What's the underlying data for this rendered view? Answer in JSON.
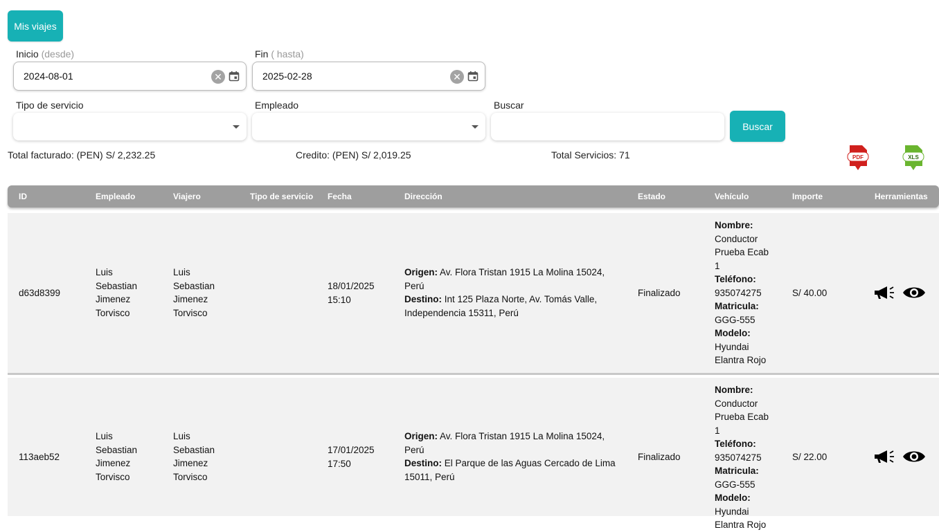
{
  "header": {
    "mis_viajes_label": "Mis viajes"
  },
  "filters": {
    "inicio_label": "Inicio",
    "inicio_hint": "(desde)",
    "inicio_value": "2024-08-01",
    "fin_label": "Fin",
    "fin_hint": "( hasta)",
    "fin_value": "2025-02-28",
    "tipo_servicio_label": "Tipo de servicio",
    "empleado_label": "Empleado",
    "buscar_label": "Buscar",
    "buscar_value": "",
    "buscar_button": "Buscar"
  },
  "summary": {
    "total_facturado": "Total facturado: (PEN) S/ 2,232.25",
    "credito": "Credito: (PEN) S/ 2,019.25",
    "total_servicios": "Total Servicios: 71",
    "pdf_label": "PDF",
    "xls_label": "XLS",
    "pdf_color": "#d0201d",
    "xls_color": "#6ab52f"
  },
  "table": {
    "columns": [
      "ID",
      "Empleado",
      "Viajero",
      "Tipo de servicio",
      "Fecha",
      "Dirección",
      "Estado",
      "Vehículo",
      "Importe",
      "Herramientas"
    ],
    "rows": [
      {
        "id": "d63d8399",
        "empleado": [
          "Luis",
          "Sebastian",
          "Jimenez",
          "Torvisco"
        ],
        "viajero": [
          "Luis",
          "Sebastian",
          "Jimenez",
          "Torvisco"
        ],
        "tipo_servicio": "",
        "fecha": [
          "18/01/2025",
          "15:10"
        ],
        "origen_label": "Origen:",
        "origen": [
          "Av. Flora Tristan 1915 La Molina 15024,",
          "Perú"
        ],
        "destino_label": "Destino:",
        "destino": [
          "Int 125 Plaza Norte, Av. Tomás Valle,",
          "Independencia 15311, Perú"
        ],
        "estado": "Finalizado",
        "vehiculo": {
          "nombre_label": "Nombre:",
          "nombre": [
            "Conductor",
            "Prueba Ecab",
            "1"
          ],
          "telefono_label": "Teléfono:",
          "telefono": "935074275",
          "matricula_label": "Matricula:",
          "matricula": "GGG-555",
          "modelo_label": "Modelo:",
          "modelo": [
            "Hyundai",
            "Elantra Rojo"
          ]
        },
        "importe": "S/ 40.00",
        "tools": [
          "megaphone-icon",
          "eye-icon"
        ]
      },
      {
        "id": "113aeb52",
        "empleado": [
          "Luis",
          "Sebastian",
          "Jimenez",
          "Torvisco"
        ],
        "viajero": [
          "Luis",
          "Sebastian",
          "Jimenez",
          "Torvisco"
        ],
        "tipo_servicio": "",
        "fecha": [
          "17/01/2025",
          "17:50"
        ],
        "origen_label": "Origen:",
        "origen": [
          "Av. Flora Tristan 1915 La Molina 15024,",
          "Perú"
        ],
        "destino_label": "Destino:",
        "destino": [
          "El Parque de las Aguas Cercado de Lima",
          "15011, Perú"
        ],
        "estado": "Finalizado",
        "vehiculo": {
          "nombre_label": "Nombre:",
          "nombre": [
            "Conductor",
            "Prueba Ecab",
            "1"
          ],
          "telefono_label": "Teléfono:",
          "telefono": "935074275",
          "matricula_label": "Matricula:",
          "matricula": "GGG-555",
          "modelo_label": "Modelo:",
          "modelo": [
            "Hyundai",
            "Elantra Rojo"
          ]
        },
        "importe": "S/ 22.00",
        "tools": [
          "megaphone-icon",
          "eye-icon"
        ]
      }
    ]
  },
  "colors": {
    "accent": "#17b1b5",
    "table_header": "#9e9e9e",
    "row_bg": "#f2f2f2"
  }
}
